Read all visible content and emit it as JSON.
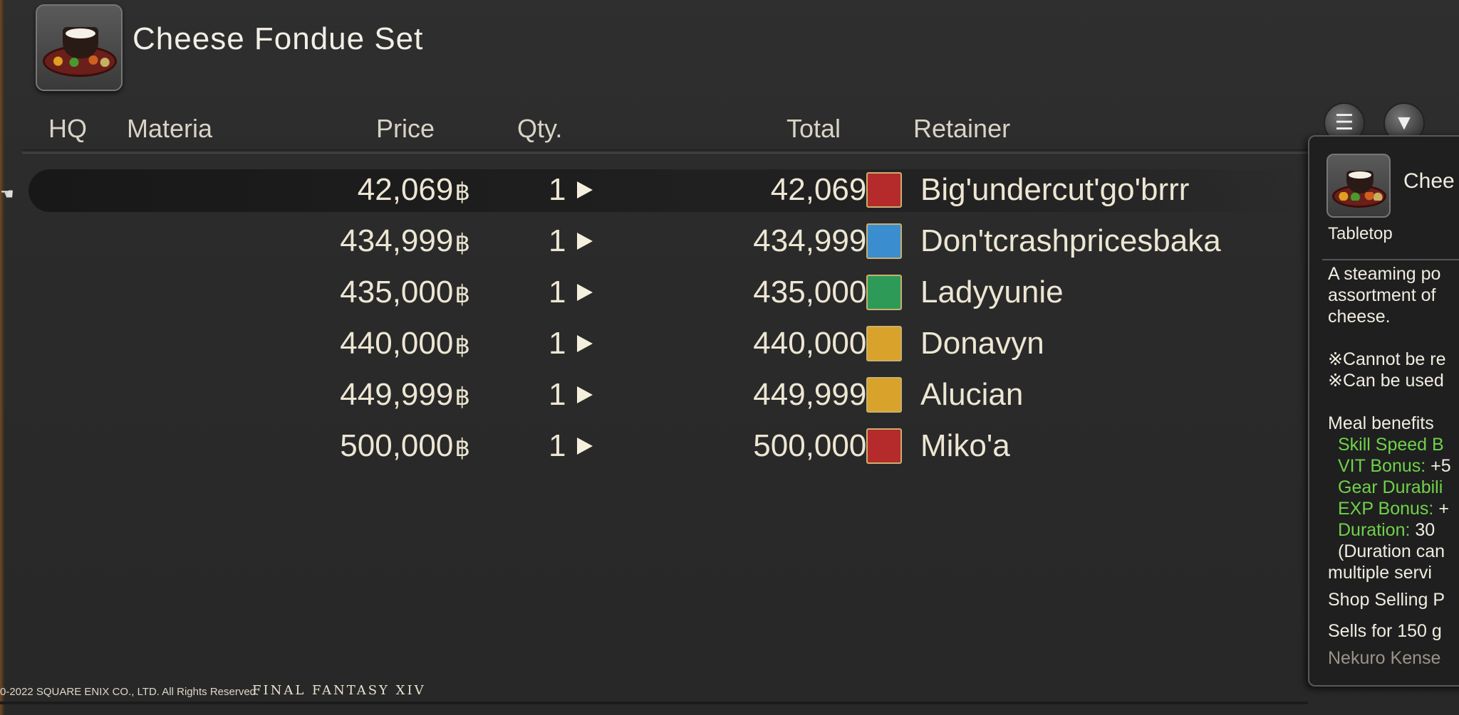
{
  "item": {
    "name": "Cheese Fondue Set"
  },
  "columns": {
    "hq": "HQ",
    "materia": "Materia",
    "price": "Price",
    "qty": "Qty.",
    "total": "Total",
    "retainer": "Retainer"
  },
  "currency_symbol": "฿",
  "listings": [
    {
      "price": "42,069",
      "qty": "1",
      "total": "42,069",
      "retainer": "Big'undercut'go'brrr",
      "city": "ul'dah-crest",
      "city_color": "#b52a2a"
    },
    {
      "price": "434,999",
      "qty": "1",
      "total": "434,999",
      "retainer": "Don'tcrashpricesbaka",
      "city": "limsa-crest",
      "city_color": "#3a8ed0"
    },
    {
      "price": "435,000",
      "qty": "1",
      "total": "435,000",
      "retainer": "Ladyyunie",
      "city": "gridania-crest",
      "city_color": "#2e9a58"
    },
    {
      "price": "440,000",
      "qty": "1",
      "total": "440,000",
      "retainer": "Donavyn",
      "city": "ishgard-crest",
      "city_color": "#d9a22a"
    },
    {
      "price": "449,999",
      "qty": "1",
      "total": "449,999",
      "retainer": "Alucian",
      "city": "ishgard-crest",
      "city_color": "#d9a22a"
    },
    {
      "price": "500,000",
      "qty": "1",
      "total": "500,000",
      "retainer": "Miko'a",
      "city": "ul'dah-crest",
      "city_color": "#b52a2a"
    }
  ],
  "tooltip": {
    "name": "Chee",
    "category": "Tabletop",
    "description": [
      "A steaming po",
      "assortment of",
      "cheese."
    ],
    "notes": [
      "※Cannot be re",
      "※Can be used"
    ],
    "meal_benefits_label": "Meal benefits",
    "benefits": [
      {
        "label": "Skill Speed B",
        "value": ""
      },
      {
        "label": "VIT Bonus:",
        "value": "+5"
      },
      {
        "label": "Gear Durabili",
        "value": ""
      },
      {
        "label": "EXP Bonus:",
        "value": "+"
      },
      {
        "label": "Duration:",
        "value": "30"
      }
    ],
    "duration_note": [
      "(Duration can",
      "multiple servi"
    ],
    "shop_selling": "Shop Selling P",
    "sells_for": "Sells for 150 g",
    "crafter": "Nekuro Kense"
  },
  "footer": {
    "copyright": "0-2022 SQUARE ENIX CO., LTD. All Rights Reserved.",
    "logo": "FINAL FANTASY XIV"
  },
  "icons": {
    "list": "list-icon",
    "filter": "filter-icon"
  }
}
